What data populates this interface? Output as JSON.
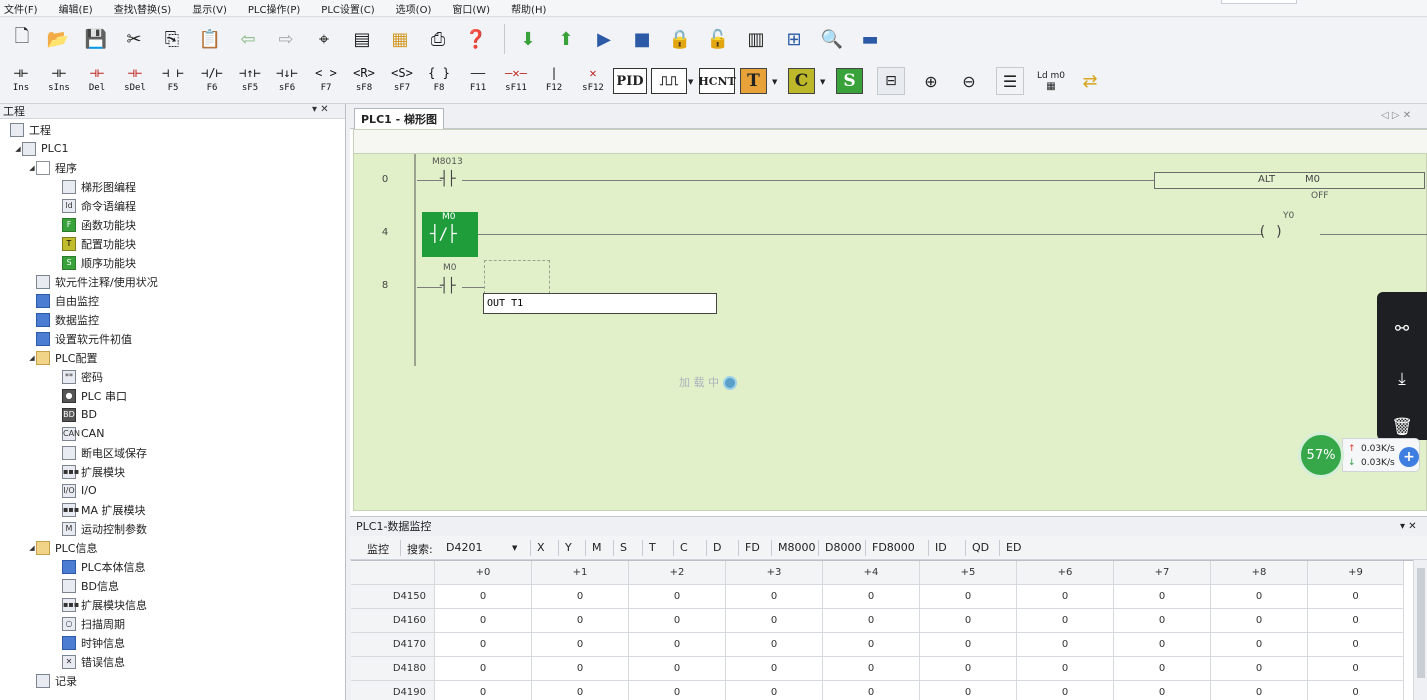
{
  "menu": [
    "文件(F)",
    "编辑(E)",
    "查找\\替换(S)",
    "显示(V)",
    "PLC操作(P)",
    "PLC设置(C)",
    "选项(O)",
    "窗口(W)",
    "帮助(H)"
  ],
  "toolbar_ladder": [
    {
      "glyph": "⊣⊢",
      "key": "Ins"
    },
    {
      "glyph": "⊣⊢",
      "key": "sIns"
    },
    {
      "glyph": "⊣⊢",
      "key": "Del",
      "red": true
    },
    {
      "glyph": "⊣⊢",
      "key": "sDel",
      "red": true
    },
    {
      "glyph": "⊣ ⊢",
      "key": "F5"
    },
    {
      "glyph": "⊣/⊢",
      "key": "F6"
    },
    {
      "glyph": "⊣↑⊢",
      "key": "sF5"
    },
    {
      "glyph": "⊣↓⊢",
      "key": "sF6"
    },
    {
      "glyph": "< >",
      "key": "F7"
    },
    {
      "glyph": "<R>",
      "key": "sF8"
    },
    {
      "glyph": "<S>",
      "key": "sF7"
    },
    {
      "glyph": "{ }",
      "key": "F8"
    },
    {
      "glyph": "——",
      "key": "F11"
    },
    {
      "glyph": "—✕—",
      "key": "sF11",
      "red": true
    },
    {
      "glyph": "|",
      "key": "F12"
    },
    {
      "glyph": "✕",
      "key": "sF12",
      "red": true
    }
  ],
  "toolbar_blocks": {
    "pid": "PID",
    "hcnt": "HCNT",
    "t": "T",
    "c": "C",
    "s": "S",
    "ldm": "Ld m0"
  },
  "left_panel": {
    "title": "工程",
    "pin": "▾ ✕",
    "items": [
      {
        "label": "工程",
        "icon": "project-icon"
      },
      {
        "label": "PLC1",
        "icon": "plc-icon"
      },
      {
        "label": "程序",
        "icon": "program-icon"
      },
      {
        "label": "梯形图编程",
        "icon": "ladder-icon"
      },
      {
        "label": "命令语编程",
        "icon": "instruction-icon"
      },
      {
        "label": "函数功能块",
        "icon": "function-block-icon"
      },
      {
        "label": "配置功能块",
        "icon": "config-block-icon"
      },
      {
        "label": "顺序功能块",
        "icon": "sequence-block-icon"
      },
      {
        "label": "软元件注释/使用状况",
        "icon": "comment-icon"
      },
      {
        "label": "自由监控",
        "icon": "free-monitor-icon"
      },
      {
        "label": "数据监控",
        "icon": "data-monitor-icon"
      },
      {
        "label": "设置软元件初值",
        "icon": "init-value-icon"
      },
      {
        "label": "PLC配置",
        "icon": "folder-icon"
      },
      {
        "label": "密码",
        "icon": "password-icon"
      },
      {
        "label": "PLC 串口",
        "icon": "serial-icon"
      },
      {
        "label": "BD",
        "icon": "bd-icon"
      },
      {
        "label": "CAN",
        "icon": "can-icon"
      },
      {
        "label": "断电区域保存",
        "icon": "power-save-icon"
      },
      {
        "label": "扩展模块",
        "icon": "ext-module-icon"
      },
      {
        "label": "I/O",
        "icon": "io-icon"
      },
      {
        "label": "MA 扩展模块",
        "icon": "ma-module-icon"
      },
      {
        "label": "运动控制参数",
        "icon": "motion-icon"
      },
      {
        "label": "PLC信息",
        "icon": "folder-icon"
      },
      {
        "label": "PLC本体信息",
        "icon": "plc-info-icon"
      },
      {
        "label": "BD信息",
        "icon": "bd-info-icon"
      },
      {
        "label": "扩展模块信息",
        "icon": "ext-info-icon"
      },
      {
        "label": "扫描周期",
        "icon": "scan-cycle-icon"
      },
      {
        "label": "时钟信息",
        "icon": "clock-icon"
      },
      {
        "label": "错误信息",
        "icon": "error-icon"
      },
      {
        "label": "记录",
        "icon": "record-icon"
      }
    ]
  },
  "ladder": {
    "tab": "PLC1 - 梯形图",
    "nav": "◁ ▷ ✕",
    "rungs": [
      {
        "step": "0",
        "contact": "M8013",
        "func": "ALT",
        "arg": "M0",
        "note": "OFF"
      },
      {
        "step": "4",
        "contact": "M0",
        "coil": "Y0"
      },
      {
        "step": "8",
        "contact": "M0"
      }
    ],
    "coil_glyph": "(          )",
    "edit_value": "OUT T1",
    "loading_text": "加 载 中"
  },
  "netmon": {
    "percent": "57%",
    "up": "0.03K/s",
    "down": "0.03K/s",
    "plus": "+"
  },
  "monitor": {
    "title": "PLC1-数据监控",
    "pin": "▾ ✕",
    "label_monitor": "监控",
    "label_search": "搜索:",
    "search_value": "D4201",
    "filters": [
      "X",
      "Y",
      "M",
      "S",
      "T",
      "C",
      "D",
      "FD",
      "M8000",
      "D8000",
      "FD8000",
      "ID",
      "QD",
      "ED"
    ],
    "columns": [
      "+0",
      "+1",
      "+2",
      "+3",
      "+4",
      "+5",
      "+6",
      "+7",
      "+8",
      "+9"
    ],
    "rows": [
      {
        "addr": "D4150",
        "vals": [
          "0",
          "0",
          "0",
          "0",
          "0",
          "0",
          "0",
          "0",
          "0",
          "0"
        ]
      },
      {
        "addr": "D4160",
        "vals": [
          "0",
          "0",
          "0",
          "0",
          "0",
          "0",
          "0",
          "0",
          "0",
          "0"
        ]
      },
      {
        "addr": "D4170",
        "vals": [
          "0",
          "0",
          "0",
          "0",
          "0",
          "0",
          "0",
          "0",
          "0",
          "0"
        ]
      },
      {
        "addr": "D4180",
        "vals": [
          "0",
          "0",
          "0",
          "0",
          "0",
          "0",
          "0",
          "0",
          "0",
          "0"
        ]
      },
      {
        "addr": "D4190",
        "vals": [
          "0",
          "0",
          "0",
          "0",
          "0",
          "0",
          "0",
          "0",
          "0",
          "0"
        ]
      }
    ]
  },
  "colors": {
    "ladder_bg": "#e1f0c8",
    "selected": "#1f9d3a",
    "accent": "#2c5aa6"
  }
}
